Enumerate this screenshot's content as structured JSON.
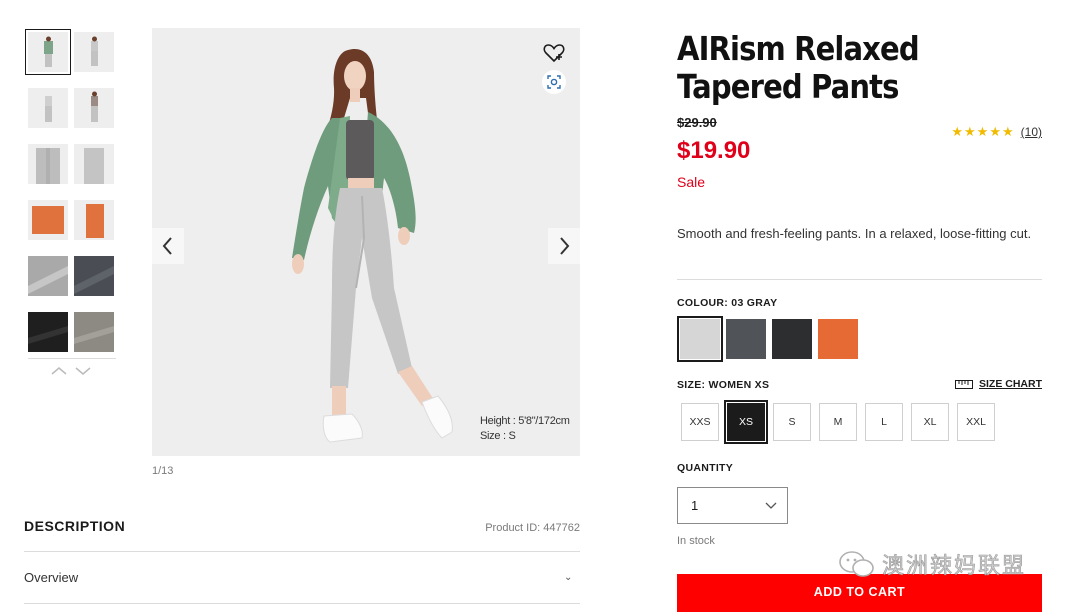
{
  "gallery": {
    "counter": "1/13",
    "model_height": "Height : 5'8\"/172cm",
    "model_size": "Size : S",
    "thumbnail_colors": [
      "#9ea59e",
      "#c7c7c7",
      "#c7c7c7",
      "#c7c7c7",
      "#bdbdbd",
      "#bdbdbd",
      "#e0733d",
      "#e0733d",
      "#a9a9a9",
      "#4a4e54",
      "#1f1f1f",
      "#8d8983"
    ]
  },
  "description": {
    "heading": "DESCRIPTION",
    "product_id": "Product ID: 447762",
    "overview_label": "Overview"
  },
  "product": {
    "title": "AIRism Relaxed Tapered Pants",
    "original_price": "$29.90",
    "price": "$19.90",
    "sale_label": "Sale",
    "stars": "★★★★★",
    "review_count": "(10)",
    "blurb": "Smooth and fresh-feeling pants. In a relaxed, loose-fitting cut."
  },
  "colour": {
    "label": "COLOUR: 03 GRAY",
    "swatches": [
      "#d6d6d6",
      "#505357",
      "#2d2e30",
      "#e66a33"
    ],
    "selected_index": 0
  },
  "size": {
    "label": "SIZE: WOMEN XS",
    "chart_link": "SIZE CHART",
    "options": [
      "XXS",
      "XS",
      "S",
      "M",
      "L",
      "XL",
      "XXL"
    ],
    "selected": "XS"
  },
  "quantity": {
    "label": "QUANTITY",
    "value": "1",
    "stock": "In stock"
  },
  "cart_button": "ADD TO CART",
  "watermark": "澳洲辣妈联盟",
  "colors": {
    "sale_red": "#e0001a",
    "cart_red": "#ff0000",
    "star": "#f0bb00"
  }
}
